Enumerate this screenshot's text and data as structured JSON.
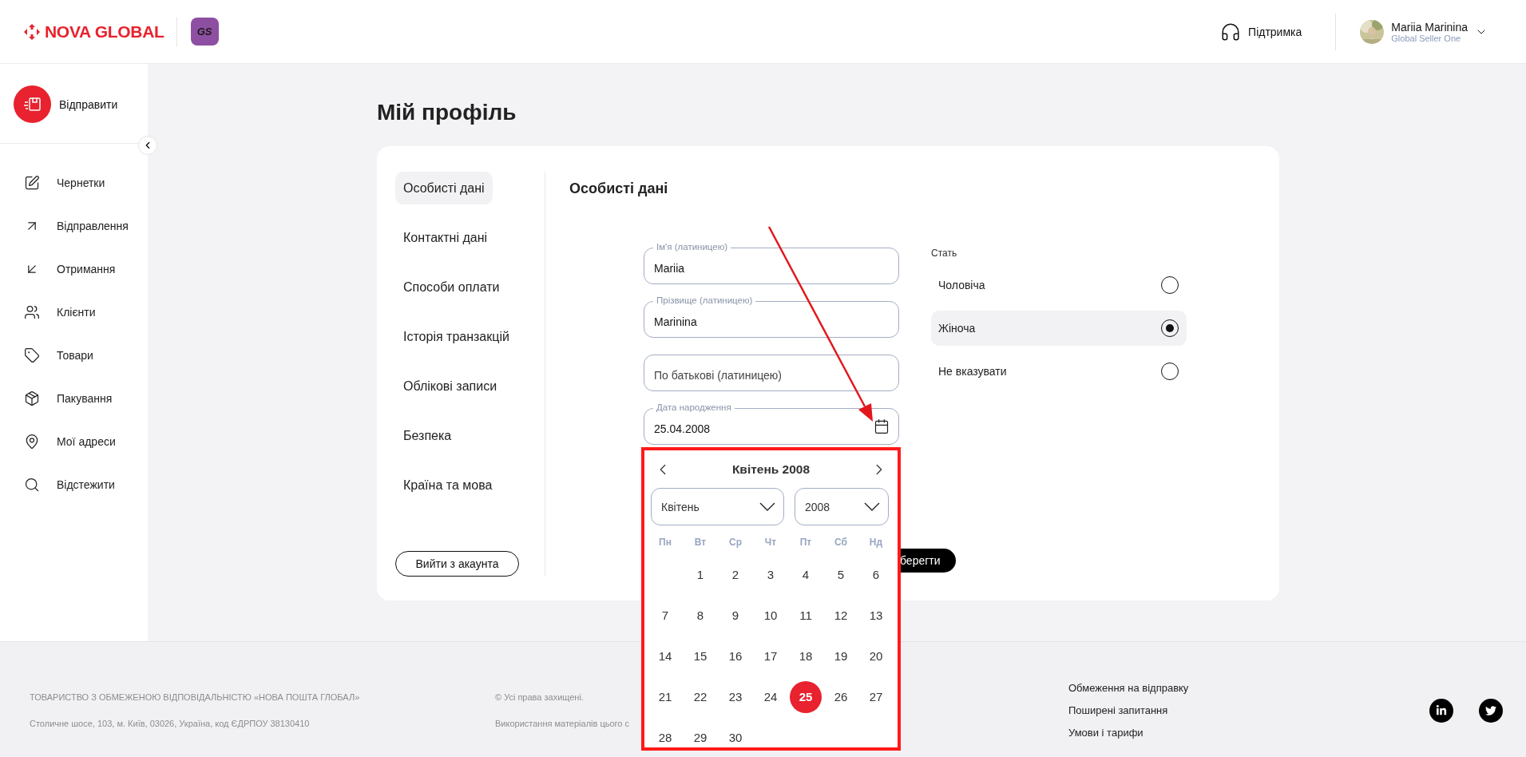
{
  "header": {
    "logo": "NOVA GLOBAL",
    "badge": "GS",
    "support": "Підтримка",
    "user": {
      "name": "Mariia Marinina",
      "role": "Global Seller One"
    }
  },
  "sidebar": {
    "primary_action": "Відправити",
    "items": [
      {
        "label": "Чернетки"
      },
      {
        "label": "Відправлення"
      },
      {
        "label": "Отримання"
      },
      {
        "label": "Клієнти"
      },
      {
        "label": "Товари"
      },
      {
        "label": "Пакування"
      },
      {
        "label": "Мої адреси"
      },
      {
        "label": "Відстежити"
      }
    ]
  },
  "page_title": "Мій профіль",
  "profile_tabs": [
    {
      "label": "Особисті дані",
      "selected": true
    },
    {
      "label": "Контактні дані",
      "selected": false
    },
    {
      "label": "Способи оплати",
      "selected": false
    },
    {
      "label": "Історія транзакцій",
      "selected": false
    },
    {
      "label": "Облікові записи",
      "selected": false
    },
    {
      "label": "Безпека",
      "selected": false
    },
    {
      "label": "Країна та мова",
      "selected": false
    }
  ],
  "logout_button": "Вийти з акаунта",
  "section_title": "Особисті дані",
  "fields": [
    {
      "kind": "text",
      "label": "Ім'я (латиницею)",
      "value": "Mariia"
    },
    {
      "kind": "text",
      "label": "Прізвище (латиницею)",
      "value": "Marinina"
    },
    {
      "kind": "text",
      "placeholder": "По батькові (латиницею)"
    },
    {
      "kind": "date",
      "label": "Дата народження",
      "value": "25.04.2008"
    }
  ],
  "gender": {
    "label": "Стать",
    "options": [
      {
        "label": "Чоловіча",
        "selected": false
      },
      {
        "label": "Жіноча",
        "selected": true
      },
      {
        "label": "Не вказувати",
        "selected": false
      }
    ]
  },
  "save_button": "берегти",
  "calendar": {
    "title": "Квітень 2008",
    "month_select": "Квітень",
    "year_select": "2008",
    "weekdays": [
      "Пн",
      "Вт",
      "Ср",
      "Чт",
      "Пт",
      "Сб",
      "Нд"
    ],
    "weeks": [
      [
        {
          "day": "1",
          "selected": false
        },
        {
          "day": "2",
          "selected": false
        },
        {
          "day": "3",
          "selected": false
        },
        {
          "day": "4",
          "selected": false
        },
        {
          "day": "5",
          "selected": false
        },
        {
          "day": "6",
          "selected": false
        }
      ],
      [
        {
          "day": "7",
          "selected": false
        },
        {
          "day": "8",
          "selected": false
        },
        {
          "day": "9",
          "selected": false
        },
        {
          "day": "10",
          "selected": false
        },
        {
          "day": "11",
          "selected": false
        },
        {
          "day": "12",
          "selected": false
        },
        {
          "day": "13",
          "selected": false
        }
      ],
      [
        {
          "day": "14",
          "selected": false
        },
        {
          "day": "15",
          "selected": false
        },
        {
          "day": "16",
          "selected": false
        },
        {
          "day": "17",
          "selected": false
        },
        {
          "day": "18",
          "selected": false
        },
        {
          "day": "19",
          "selected": false
        },
        {
          "day": "20",
          "selected": false
        }
      ],
      [
        {
          "day": "21",
          "selected": false
        },
        {
          "day": "22",
          "selected": false
        },
        {
          "day": "23",
          "selected": false
        },
        {
          "day": "24",
          "selected": false
        },
        {
          "day": "25",
          "selected": true
        },
        {
          "day": "26",
          "selected": false
        },
        {
          "day": "27",
          "selected": false
        }
      ],
      [
        {
          "day": "28",
          "selected": false
        },
        {
          "day": "29",
          "selected": false
        },
        {
          "day": "30",
          "selected": false
        }
      ]
    ]
  },
  "footer": {
    "company": "ТОВАРИСТВО З ОБМЕЖЕНОЮ ВІДПОВІДАЛЬНІСТЮ «НОВА ПОШТА ГЛОБАЛ»",
    "address": "Столичне шосе, 103, м. Київ, 03026, Україна, код ЄДРПОУ 38130410",
    "copyright": "© Усі права захищені.",
    "usage": "Використання матеріалів цього с",
    "links": [
      "Обмеження на відправку",
      "Поширені запитання",
      "Умови і тарифи"
    ]
  }
}
